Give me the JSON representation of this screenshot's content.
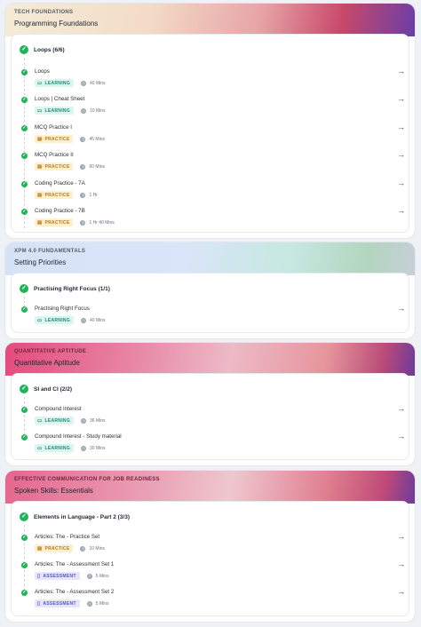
{
  "cards": [
    {
      "category": "TECH FOUNDATIONS",
      "title": "Programming Foundations",
      "section": "Loops (6/6)",
      "items": [
        {
          "name": "Loops",
          "type": "LEARNING",
          "duration": "40 Mins"
        },
        {
          "name": "Loops | Cheat Sheet",
          "type": "LEARNING",
          "duration": "10 Mins"
        },
        {
          "name": "MCQ Practice I",
          "type": "PRACTICE",
          "duration": "45 Mins"
        },
        {
          "name": "MCQ Practice II",
          "type": "PRACTICE",
          "duration": "60 Mins"
        },
        {
          "name": "Coding Practice - 7A",
          "type": "PRACTICE",
          "duration": "1 Hr"
        },
        {
          "name": "Coding Practice - 7B",
          "type": "PRACTICE",
          "duration": "1 Hr 40 Mins"
        }
      ]
    },
    {
      "category": "XPM 4.0 FUNDAMENTALS",
      "title": "Setting Priorities",
      "section": "Practising Right Focus (1/1)",
      "items": [
        {
          "name": "Practising Right Focus",
          "type": "LEARNING",
          "duration": "40 Mins"
        }
      ]
    },
    {
      "category": "QUANTITATIVE APTITUDE",
      "title": "Quantitative Aptitude",
      "section": "SI and CI (2/2)",
      "items": [
        {
          "name": "Compound Interest",
          "type": "LEARNING",
          "duration": "36 Mins"
        },
        {
          "name": "Compound Interest - Study material",
          "type": "LEARNING",
          "duration": "30 Mins"
        }
      ]
    },
    {
      "category": "EFFECTIVE COMMUNICATION FOR JOB READINESS",
      "title": "Spoken Skills: Essentials",
      "section": "Elements in Language - Part 2 (3/3)",
      "items": [
        {
          "name": "Articles: The - Practice Set",
          "type": "PRACTICE",
          "duration": "10 Mins"
        },
        {
          "name": "Articles: The - Assessment Set 1",
          "type": "ASSESSMENT",
          "duration": "5 Mins"
        },
        {
          "name": "Articles: The - Assessment Set 2",
          "type": "ASSESSMENT",
          "duration": "5 Mins"
        }
      ]
    }
  ],
  "icons": {
    "check": "check-circle-icon",
    "learning": "book-icon",
    "practice": "clipboard-icon",
    "assessment": "document-icon",
    "duration": "clock-icon",
    "open": "arrow-right-icon"
  },
  "colors": {
    "complete": "#20b358",
    "learning_bg": "#dcf6ef",
    "practice_bg": "#fdf0cf",
    "assessment_bg": "#e5e6fb"
  }
}
